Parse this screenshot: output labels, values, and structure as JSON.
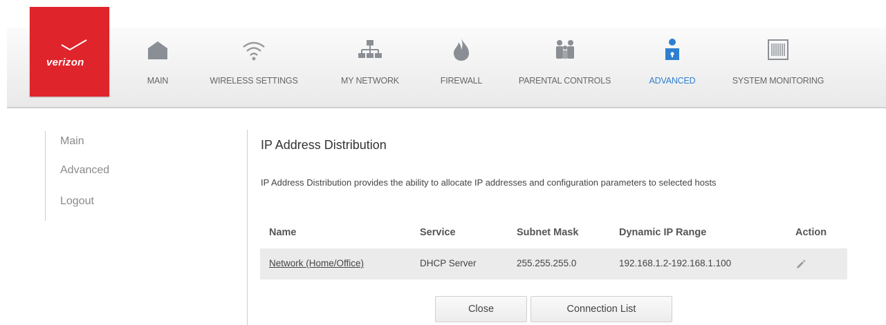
{
  "brand": {
    "logo_text": "verizon",
    "color": "#e0242b"
  },
  "nav": {
    "items": [
      {
        "label": "MAIN",
        "icon": "home-icon"
      },
      {
        "label": "WIRELESS SETTINGS",
        "icon": "wifi-icon"
      },
      {
        "label": "MY NETWORK",
        "icon": "network-icon"
      },
      {
        "label": "FIREWALL",
        "icon": "flame-icon"
      },
      {
        "label": "PARENTAL CONTROLS",
        "icon": "family-icon"
      },
      {
        "label": "ADVANCED",
        "icon": "advanced-user-icon",
        "active": true
      },
      {
        "label": "SYSTEM MONITORING",
        "icon": "monitoring-icon"
      }
    ],
    "active_color": "#2e7fd0"
  },
  "sidebar": {
    "items": [
      {
        "label": "Main"
      },
      {
        "label": "Advanced"
      },
      {
        "label": "Logout"
      }
    ]
  },
  "main": {
    "title": "IP Address Distribution",
    "description": "IP Address Distribution provides the ability to allocate IP addresses and configuration parameters to selected hosts",
    "table": {
      "headers": [
        "Name",
        "Service",
        "Subnet Mask",
        "Dynamic IP Range",
        "Action"
      ],
      "rows": [
        {
          "name": "Network (Home/Office)",
          "service": "DHCP Server",
          "subnet": "255.255.255.0",
          "range": "192.168.1.2-192.168.1.100",
          "action_icon": "edit-pencil-icon"
        }
      ]
    },
    "buttons": {
      "close": "Close",
      "connection_list": "Connection List"
    }
  }
}
